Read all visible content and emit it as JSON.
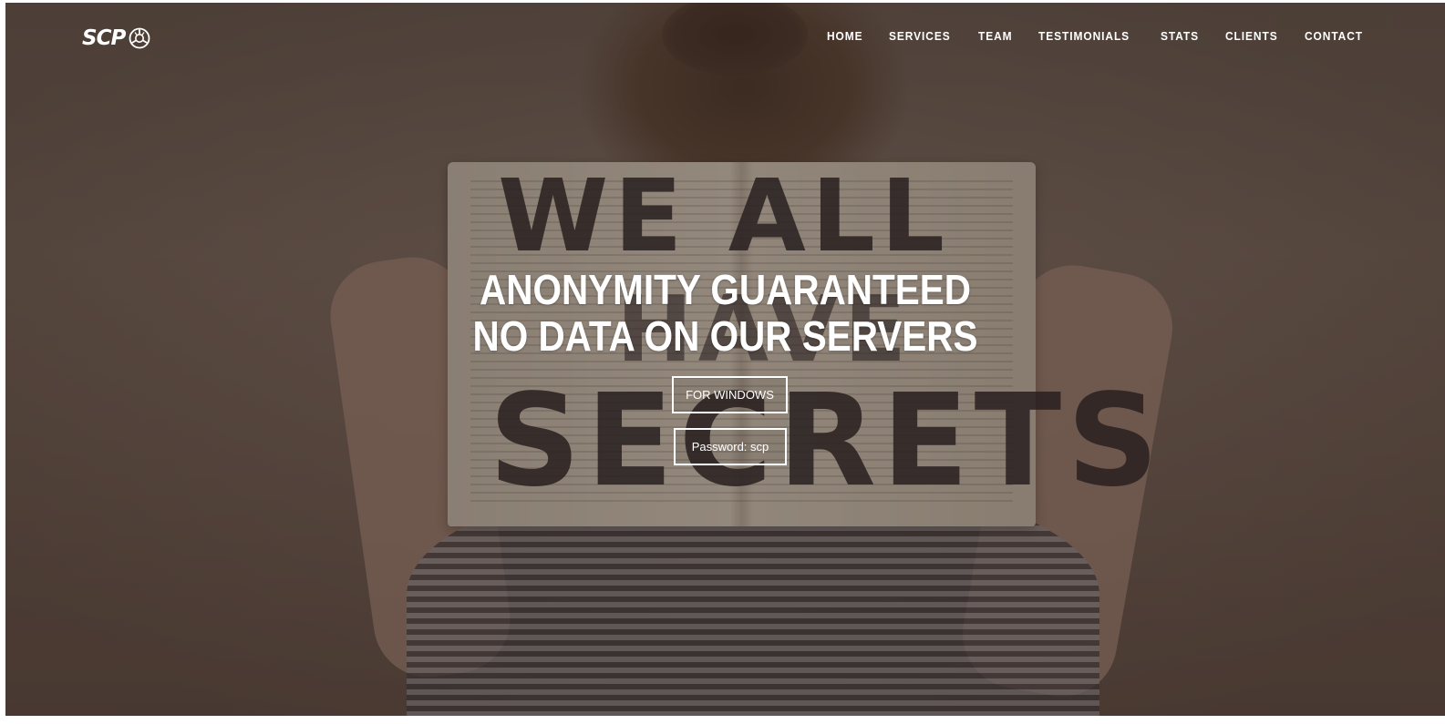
{
  "brand": {
    "logo_text": "SCP",
    "logo_icon": "scp-foundation-seal-icon"
  },
  "nav": {
    "items": [
      {
        "label": "HOME"
      },
      {
        "label": "SERVICES"
      },
      {
        "label": "TEAM"
      },
      {
        "label": "TESTIMONIALS"
      },
      {
        "label": "STATS"
      },
      {
        "label": "CLIENTS"
      },
      {
        "label": "CONTACT"
      }
    ]
  },
  "hero": {
    "headline_line1": "ANONYMITY GUARANTEED",
    "headline_line2": "NO DATA ON OUR SERVERS",
    "primary_button": "FOR WINDOWS",
    "secondary_button": "Password: scp",
    "background_sign_text": [
      "WE ALL",
      "HAVE",
      "SECRETS"
    ]
  },
  "colors": {
    "text": "#ffffff",
    "overlay": "#281e19",
    "page_background": "#ffffff"
  }
}
